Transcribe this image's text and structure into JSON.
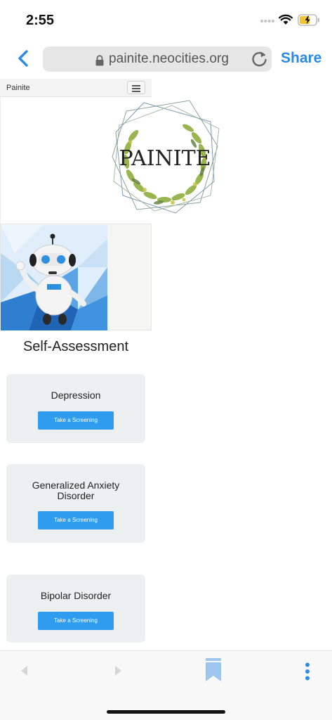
{
  "status_bar": {
    "time": "2:55",
    "battery_icon": "battery-charging-icon",
    "wifi_icon": "wifi-icon"
  },
  "browser": {
    "url": "painite.neocities.org",
    "share_label": "Share",
    "icons": {
      "back": "chevron-left-icon",
      "lock": "lock-icon",
      "reload": "reload-icon"
    },
    "accent_color": "#2a8ae6"
  },
  "site": {
    "brand": "Painite",
    "logo_text": "PAINITE",
    "section_title": "Self-Assessment",
    "button_color": "#2f9cf0",
    "cards": [
      {
        "title": "Depression",
        "button_label": "Take a Screening"
      },
      {
        "title": "Generalized Anxiety Disorder",
        "button_label": "Take a Screening"
      },
      {
        "title": "Bipolar Disorder",
        "button_label": "Take a Screening"
      }
    ]
  },
  "toolbar": {
    "icons": [
      "back-arrow-icon",
      "forward-arrow-icon",
      "bookmarks-icon",
      "more-options-icon"
    ]
  }
}
